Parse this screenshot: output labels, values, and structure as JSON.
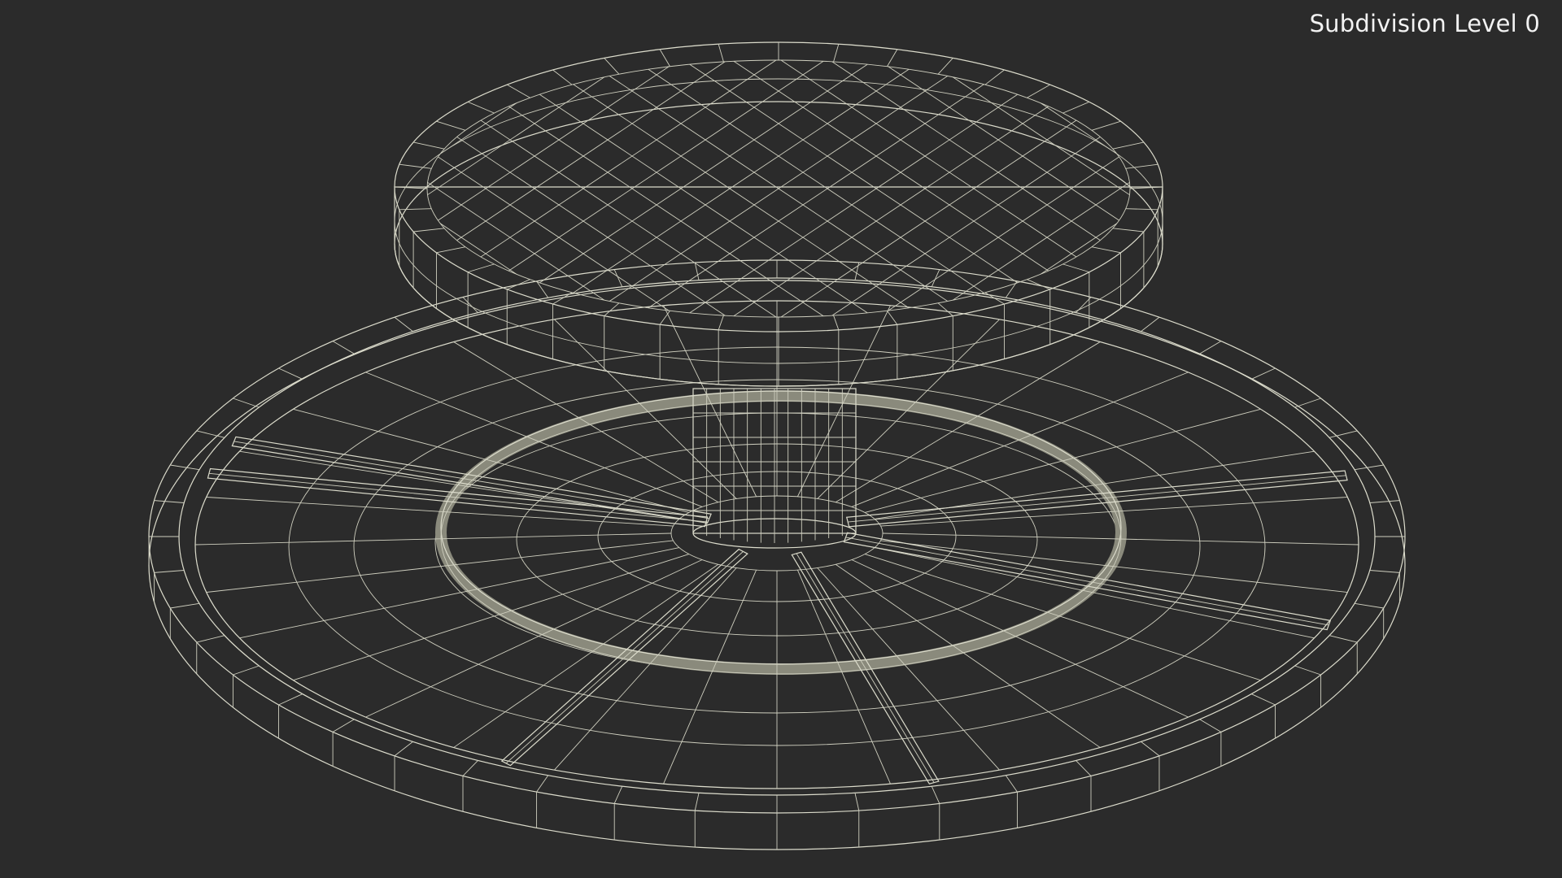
{
  "viewport": {
    "background_color": "#2b2b2b",
    "label_color": "#f2f2f2",
    "mesh_face_color": "#76766a",
    "mesh_dark_color": "#4a4a43",
    "wire_color": "#dcdccc"
  },
  "overlay": {
    "subdivision_label": "Subdivision Level 0"
  }
}
